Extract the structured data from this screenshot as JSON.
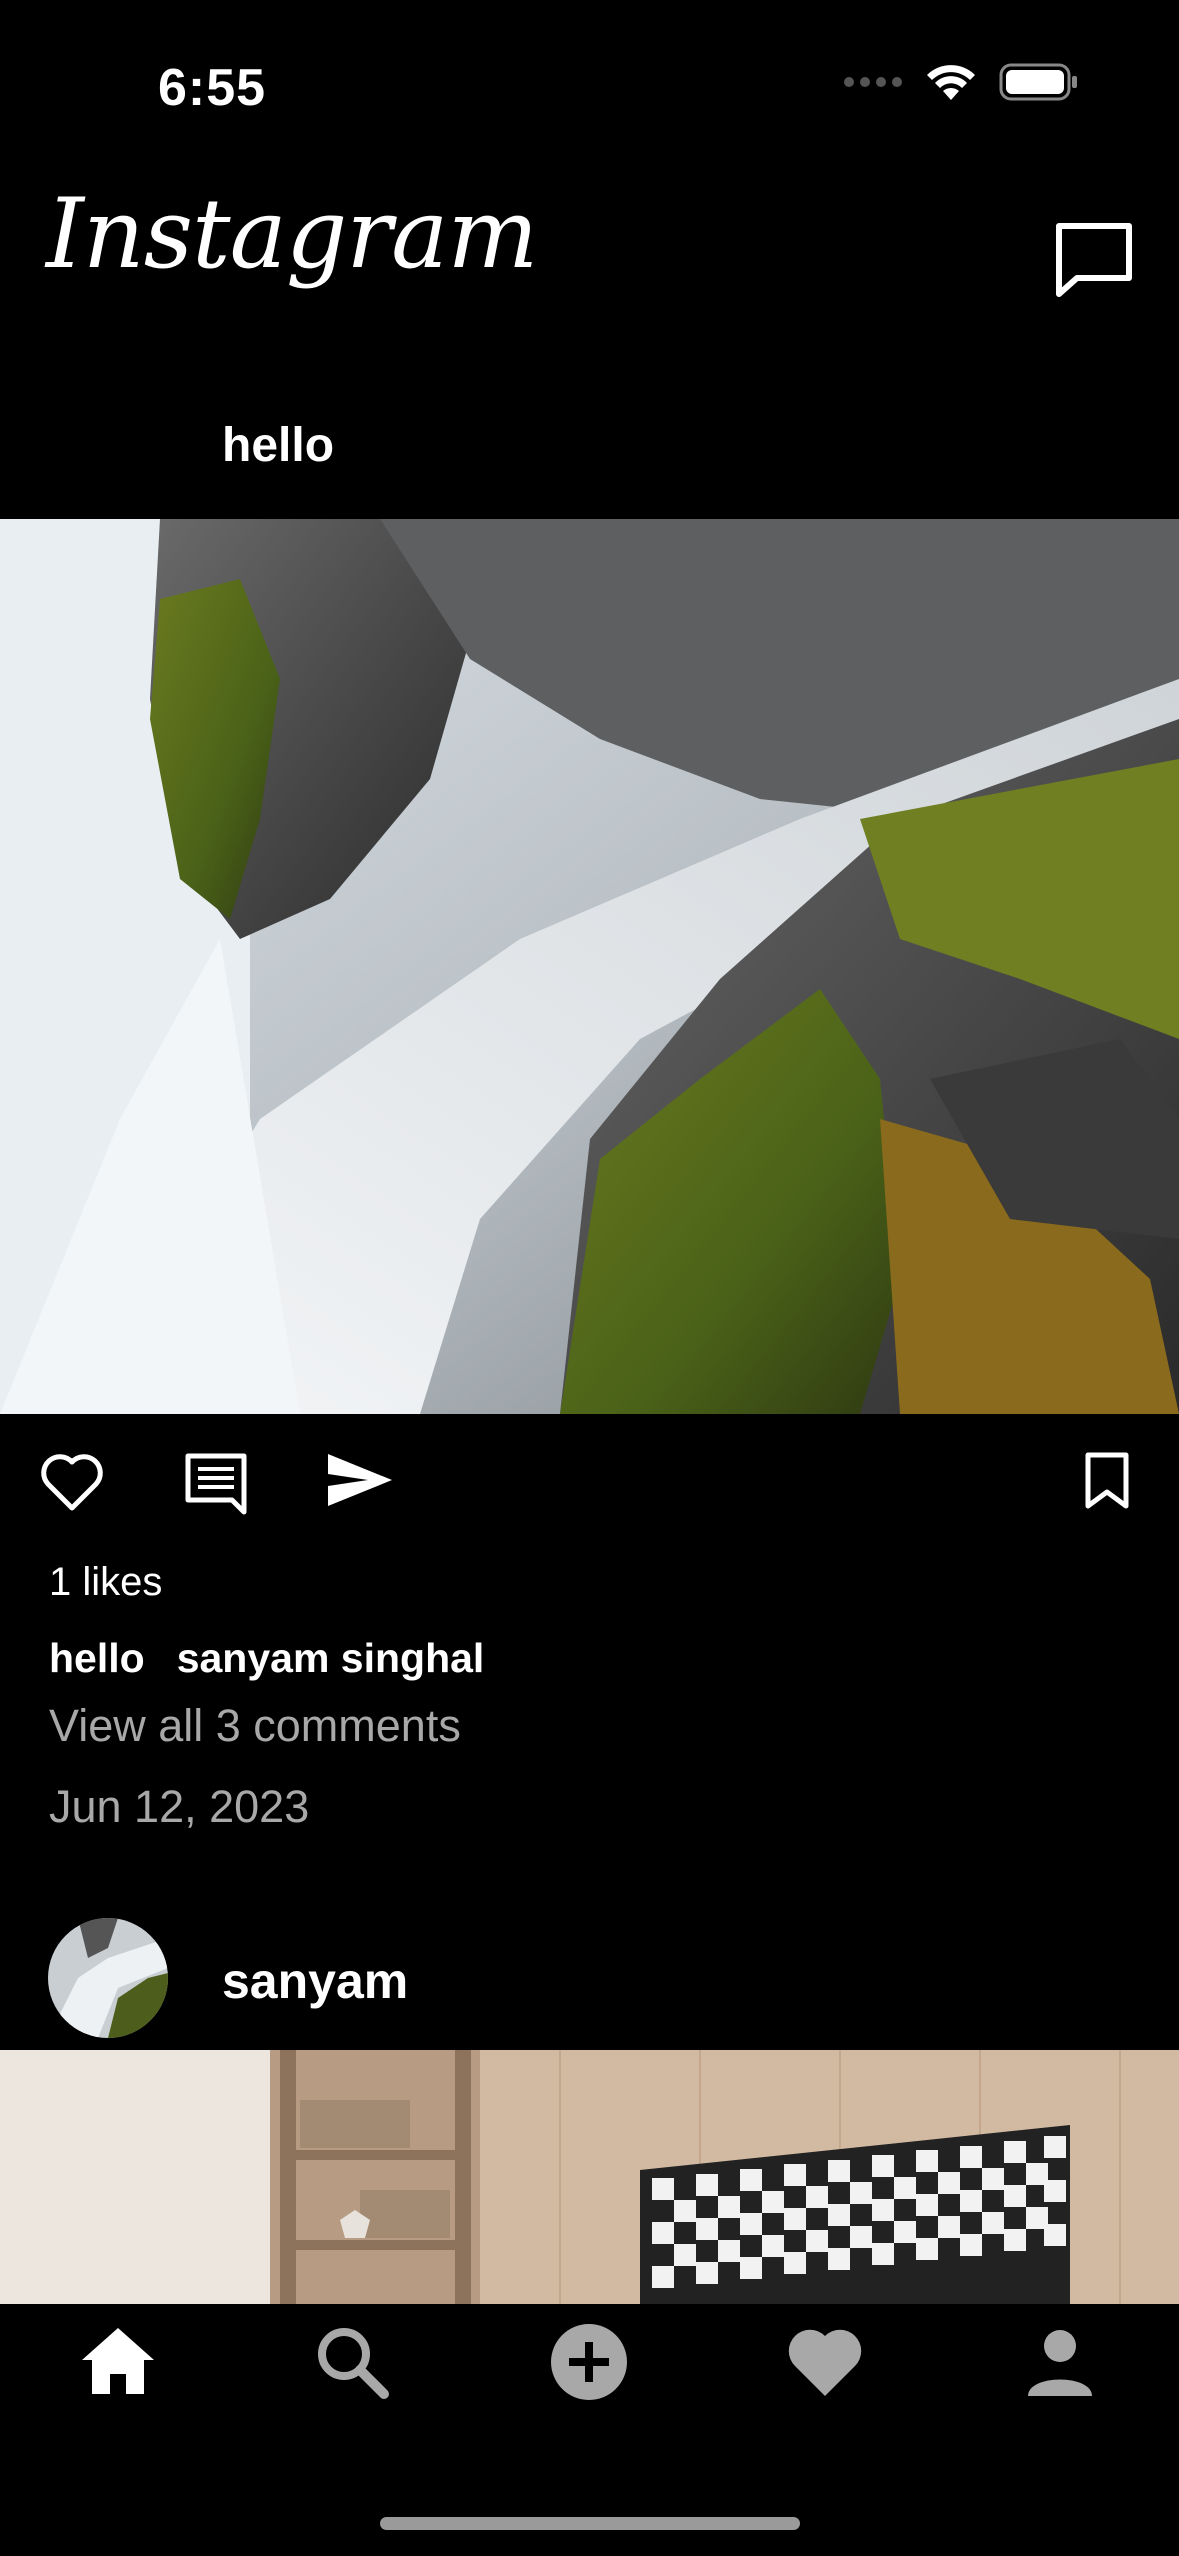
{
  "status_bar": {
    "time": "6:55"
  },
  "header": {
    "app_title": "Instagram"
  },
  "post1": {
    "username": "hello",
    "likes": "1 likes",
    "caption_user": "hello",
    "caption_text": "sanyam singhal",
    "view_comments": "View all 3 comments",
    "date": "Jun 12, 2023"
  },
  "post2": {
    "username": "sanyam"
  },
  "icons": {
    "messages": "message-square-icon",
    "like": "heart-outline-icon",
    "comment": "comment-icon",
    "share": "send-icon",
    "save": "bookmark-icon",
    "home": "home-icon",
    "search": "search-icon",
    "add": "add-circle-icon",
    "activity": "heart-filled-icon",
    "profile": "person-icon"
  },
  "colors": {
    "background": "#000000",
    "text": "#ffffff",
    "muted": "#a8a8a8",
    "tab_inactive": "#a8a8a8"
  }
}
